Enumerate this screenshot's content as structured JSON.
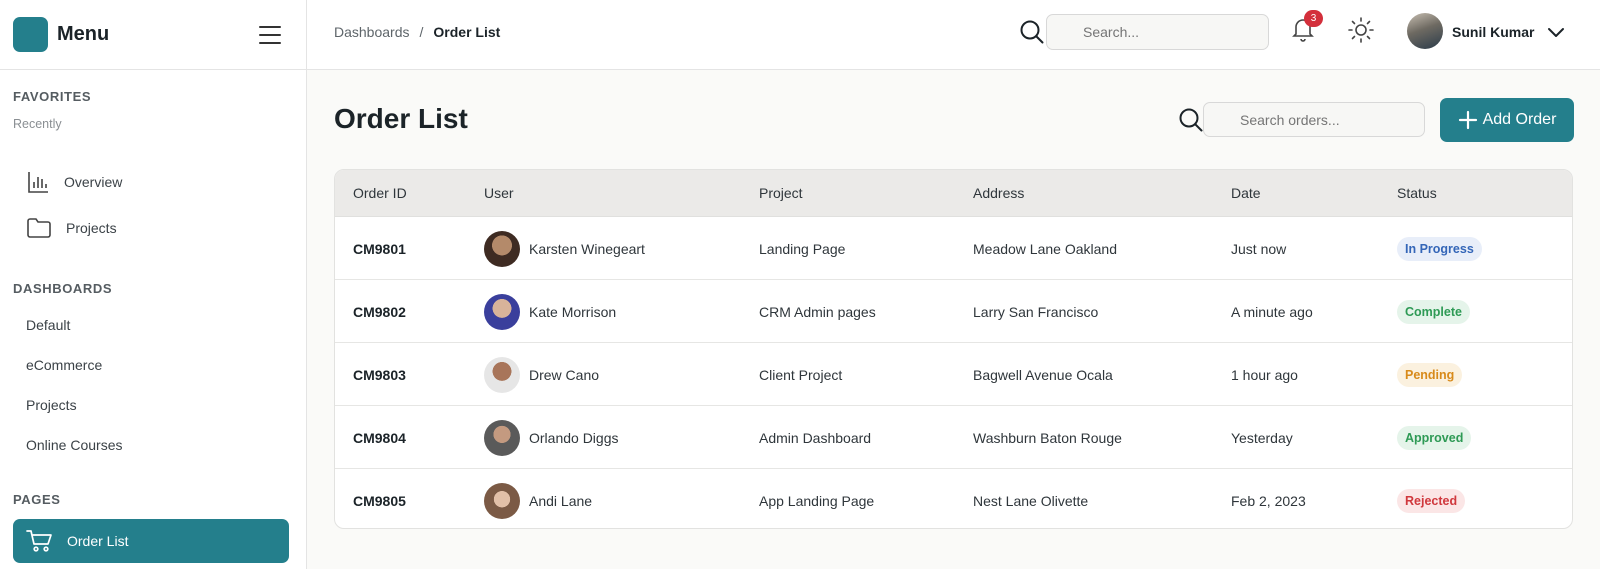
{
  "sidebar": {
    "menu_title": "Menu",
    "favorites_title": "FAVORITES",
    "favorites_sub": "Recently",
    "fav_items": [
      {
        "label": "Overview",
        "icon": "chart-bar-icon"
      },
      {
        "label": "Projects",
        "icon": "folder-icon"
      }
    ],
    "dashboards_title": "DASHBOARDS",
    "dashboard_items": [
      "Default",
      "eCommerce",
      "Projects",
      "Online Courses"
    ],
    "pages_title": "PAGES",
    "active_item": {
      "label": "Order List",
      "icon": "cart-icon"
    }
  },
  "topbar": {
    "breadcrumb": [
      "Dashboards",
      "/",
      "Order List"
    ],
    "search_placeholder": "Search...",
    "notification_count": "3",
    "user_name": "Sunil Kumar"
  },
  "main": {
    "title": "Order List",
    "search_placeholder": "Search orders...",
    "add_button": "Add Order",
    "columns": [
      "Order ID",
      "User",
      "Project",
      "Address",
      "Date",
      "Status"
    ],
    "rows": [
      {
        "id": "CM9801",
        "user": "Karsten Winegeart",
        "project": "Landing Page",
        "address": "Meadow Lane Oakland",
        "date": "Just now",
        "status": "In Progress"
      },
      {
        "id": "CM9802",
        "user": "Kate Morrison",
        "project": "CRM Admin pages",
        "address": "Larry San Francisco",
        "date": "A minute ago",
        "status": "Complete"
      },
      {
        "id": "CM9803",
        "user": "Drew Cano",
        "project": "Client Project",
        "address": "Bagwell Avenue Ocala",
        "date": "1 hour ago",
        "status": "Pending"
      },
      {
        "id": "CM9804",
        "user": "Orlando Diggs",
        "project": "Admin Dashboard",
        "address": "Washburn Baton Rouge",
        "date": "Yesterday",
        "status": "Approved"
      },
      {
        "id": "CM9805",
        "user": "Andi Lane",
        "project": "App Landing Page",
        "address": "Nest Lane Olivette",
        "date": "Feb 2, 2023",
        "status": "Rejected"
      }
    ]
  },
  "colors": {
    "accent": "#247f8c",
    "status_in_progress": "#3466b8",
    "status_complete": "#2e9a55",
    "status_pending": "#d88a1a",
    "status_approved": "#2e9a55",
    "status_rejected": "#d0383d",
    "badge": "#d32f3b"
  }
}
